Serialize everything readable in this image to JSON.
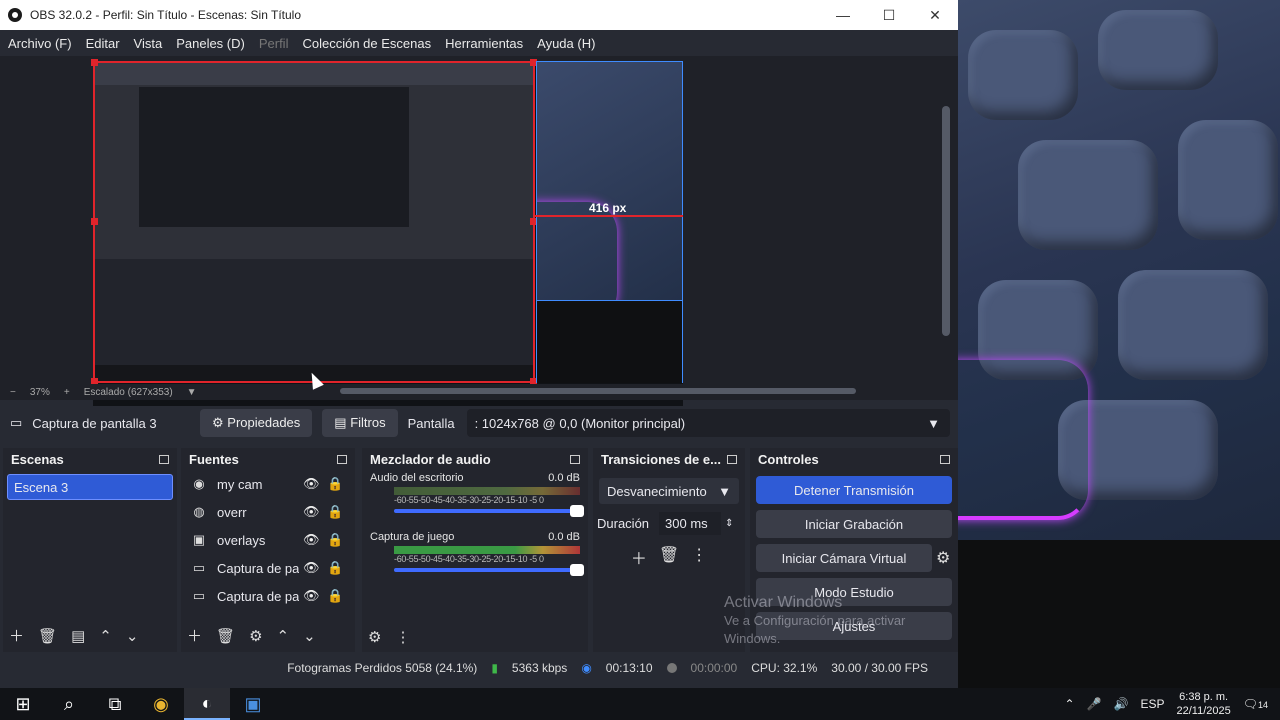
{
  "window": {
    "title": "OBS 32.0.2 - Perfil: Sin Título - Escenas: Sin Título"
  },
  "menu": [
    "Archivo (F)",
    "Editar",
    "Vista",
    "Paneles (D)",
    "Perfil",
    "Colección de Escenas",
    "Herramientas",
    "Ayuda (H)"
  ],
  "preview": {
    "size_label": "416 px"
  },
  "zoom": {
    "level": "37%",
    "scaling": "Escalado (627x353)"
  },
  "source_toolbar": {
    "source_name": "Captura de pantalla 3",
    "properties": "Propiedades",
    "filters": "Filtros",
    "display_label": "Pantalla",
    "display_value": ": 1024x768 @ 0,0 (Monitor principal)"
  },
  "scenes": {
    "title": "Escenas",
    "items": [
      "Escena 3"
    ]
  },
  "sources": {
    "title": "Fuentes",
    "items": [
      {
        "name": "my cam",
        "icon": "camera-icon"
      },
      {
        "name": "overr",
        "icon": "browser-icon"
      },
      {
        "name": "overlays",
        "icon": "image-icon"
      },
      {
        "name": "Captura de pa",
        "icon": "monitor-icon"
      },
      {
        "name": "Captura de pa",
        "icon": "monitor-icon"
      }
    ]
  },
  "mixer": {
    "title": "Mezclador de audio",
    "scale": "-60-55-50-45-40-35-30-25-20-15-10 -5 0",
    "channels": [
      {
        "name": "Audio del escritorio",
        "db": "0.0 dB",
        "muted": true
      },
      {
        "name": "Captura de juego",
        "db": "0.0 dB",
        "muted": false
      }
    ]
  },
  "transitions": {
    "title": "Transiciones de e...",
    "selected": "Desvanecimiento",
    "duration_label": "Duración",
    "duration_value": "300 ms"
  },
  "controls": {
    "title": "Controles",
    "stop_stream": "Detener Transmisión",
    "start_record": "Iniciar Grabación",
    "virtual_cam": "Iniciar Cámara Virtual",
    "studio_mode": "Modo Estudio",
    "settings": "Ajustes"
  },
  "status": {
    "dropped_frames": "Fotogramas Perdidos 5058 (24.1%)",
    "bitrate": "5363 kbps",
    "stream_time": "00:13:10",
    "record_time": "00:00:00",
    "cpu": "CPU: 32.1%",
    "fps": "30.00 / 30.00 FPS"
  },
  "watermark": {
    "title": "Activar Windows",
    "subtitle": "Ve a Configuración para activar Windows."
  },
  "taskbar": {
    "lang": "ESP",
    "time": "6:38 p. m.",
    "date": "22/11/2025",
    "notifications": "14"
  },
  "colors": {
    "accent": "#2f5bd6",
    "selection_red": "#e0242b",
    "neon": "#d63cff"
  }
}
